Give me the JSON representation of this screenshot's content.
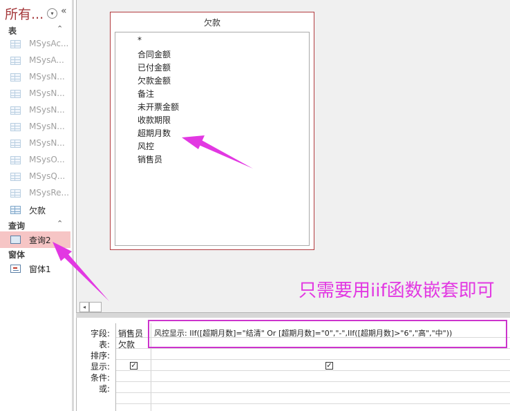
{
  "nav": {
    "title": "所有...",
    "dropdown_glyph": "▾",
    "collapse_glyph": "«",
    "groups": {
      "tables": {
        "label": "表",
        "chevron": "⌃"
      },
      "queries": {
        "label": "查询",
        "chevron": "⌃"
      },
      "forms": {
        "label": "窗体"
      }
    },
    "system_tables": [
      "MSysAc...",
      "MSysA...",
      "MSysN...",
      "MSysN...",
      "MSysN...",
      "MSysN...",
      "MSysN...",
      "MSysO...",
      "MSysQ...",
      "MSysRe..."
    ],
    "table_item": "欠款",
    "query_item": "查询2",
    "form_item": "窗体1"
  },
  "design": {
    "table_title": "欠款",
    "fields": [
      "*",
      "合同金额",
      "已付金额",
      "欠款金额",
      "备注",
      "未开票金额",
      "收款期限",
      "超期月数",
      "风控",
      "销售员"
    ],
    "scroll_left_glyph": "◂"
  },
  "qbe": {
    "row_labels": [
      "字段:",
      "表:",
      "排序:",
      "显示:",
      "条件:",
      "或:"
    ],
    "columns": [
      {
        "field": "销售员",
        "table": "欠款",
        "show": true
      },
      {
        "field": "风控显示: IIf([超期月数]=\"结清\" Or [超期月数]=\"0\",\"-\",IIf([超期月数]>\"6\",\"高\",\"中\"))",
        "table": "",
        "show": true
      }
    ],
    "check_glyph": "✓"
  },
  "annotation": {
    "text": "只需要用iif函数嵌套即可",
    "color": "#e238e2"
  },
  "colors": {
    "accent": "#a4373a",
    "selected_bg": "#f6c5c5",
    "annotation": "#e238e2"
  }
}
